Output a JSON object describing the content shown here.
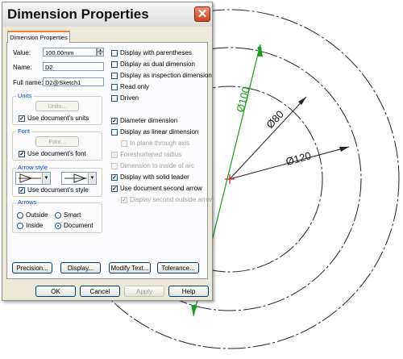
{
  "dialog": {
    "title": "Dimension Properties",
    "close_glyph": "✕",
    "tab_label": "Dimension Properties",
    "value_label": "Value:",
    "value": "100.00mm",
    "name_label": "Name:",
    "name": "D2",
    "fullname_label": "Full name:",
    "fullname": "D2@Sketch1",
    "units": {
      "title": "Units",
      "button": "Units...",
      "checkbox": "Use document's units",
      "checked": true
    },
    "font": {
      "title": "Font",
      "button": "Font...",
      "checkbox": "Use document's font",
      "checked": true
    },
    "arrow_style": {
      "title": "Arrow style",
      "checkbox": "Use document's style",
      "checked": true
    },
    "arrows": {
      "title": "Arrows",
      "options": [
        "Outside",
        "Smart",
        "Inside",
        "Document"
      ],
      "selected": "Document"
    },
    "options": [
      {
        "label": "Display with parentheses",
        "checked": false,
        "enabled": true
      },
      {
        "label": "Display as dual dimension",
        "checked": false,
        "enabled": true
      },
      {
        "label": "Display as inspection dimension",
        "checked": false,
        "enabled": true
      },
      {
        "label": "Read only",
        "checked": false,
        "enabled": true
      },
      {
        "label": "Driven",
        "checked": false,
        "enabled": true
      },
      {
        "label": "Diameter dimension",
        "checked": true,
        "enabled": true
      },
      {
        "label": "Display as linear dimension",
        "checked": false,
        "enabled": true
      },
      {
        "label": "In plane through axis",
        "checked": false,
        "enabled": false
      },
      {
        "label": "Foreshortened radius",
        "checked": false,
        "enabled": false
      },
      {
        "label": "Dimension to inside of arc",
        "checked": false,
        "enabled": false
      },
      {
        "label": "Display with solid leader",
        "checked": true,
        "enabled": true
      },
      {
        "label": "Use document second arrow",
        "checked": true,
        "enabled": true
      },
      {
        "label": "Display second outside arrow",
        "checked": true,
        "enabled": false
      }
    ],
    "bottom_buttons": {
      "precision": "Precision...",
      "display": "Display...",
      "modify_text": "Modify Text...",
      "tolerance": "Tolerance..."
    },
    "footer_buttons": {
      "ok": "OK",
      "cancel": "Cancel",
      "apply": "Apply",
      "help": "Help"
    }
  },
  "drawing": {
    "dimensions": [
      "Ø100",
      "Ø80",
      "Ø120"
    ],
    "colors": {
      "selected_dimension": "#1e9a1e",
      "center_mark": "#d42020",
      "geometry": "#222222"
    }
  }
}
